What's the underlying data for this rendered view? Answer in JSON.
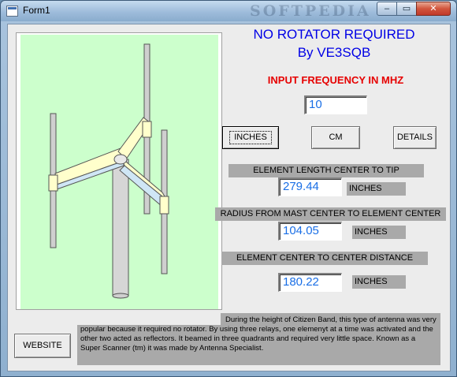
{
  "window": {
    "title": "Form1",
    "watermark": "SOFTPEDIA",
    "controls": {
      "minimize": "–",
      "maximize": "▭",
      "close": "✕"
    }
  },
  "headings": {
    "line1": "NO ROTATOR REQUIRED",
    "line2": "By VE3SQB"
  },
  "frequency": {
    "label": "INPUT FREQUENCY IN MHZ",
    "value": "10"
  },
  "unit_buttons": {
    "inches": "INCHES",
    "cm": "CM",
    "details": "DETAILS"
  },
  "results": [
    {
      "label": "ELEMENT LENGTH CENTER TO TIP",
      "value": "279.44",
      "unit": "INCHES"
    },
    {
      "label": "RADIUS FROM MAST CENTER TO ELEMENT CENTER",
      "value": "104.05",
      "unit": "INCHES"
    },
    {
      "label": "ELEMENT CENTER TO CENTER DISTANCE",
      "value": "180.22",
      "unit": "INCHES"
    }
  ],
  "website_button": "WEBSITE",
  "description": "During the height of Citizen Band, this type of antenna was very popular because it required no rotator. By using three relays, one elemenyt at a time was activated and the other two acted as reflectors. It beamed in three quadrants and required very little space. Known as a Super Scanner (tm) it was made by Antenna Specialist.",
  "colors": {
    "heading": "#0000e6",
    "frequency_label": "#e60000",
    "value_text": "#1a6fe6",
    "antenna_background": "#ccffcc",
    "label_background": "#a9a9a9"
  }
}
